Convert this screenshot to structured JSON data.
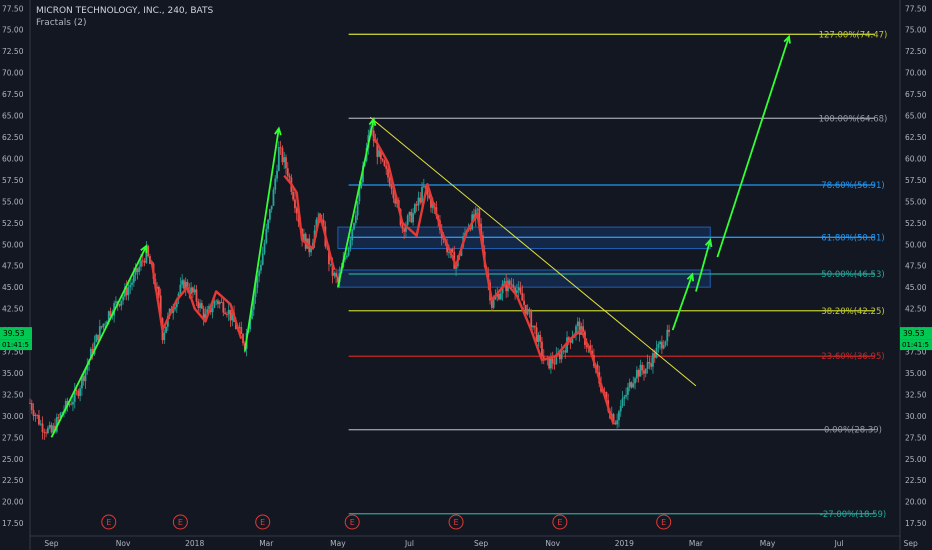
{
  "header": {
    "symbol_title": "MICRON TECHNOLOGY, INC., 240, BATS",
    "indicator": "Fractals (2)"
  },
  "price_labels": {
    "last_price": "39.53",
    "countdown": "01:41:5"
  },
  "colors": {
    "background": "#131722",
    "candle_up": "#26a69a",
    "candle_down": "#ef5350",
    "fib_grey": "#9598a1",
    "fib_blue": "#2196f3",
    "fib_teal": "#26a69a",
    "fib_olive": "#c0ca33",
    "fib_red": "#c62828",
    "trend_green": "#33ff33",
    "trend_red": "#e53935",
    "trendline_yellow": "#e0e040",
    "earnings_badge": "#e53935"
  },
  "chart_data": {
    "type": "candlestick",
    "title": "MICRON TECHNOLOGY, INC., 240, BATS",
    "yaxis": {
      "min": 16,
      "max": 78,
      "ticks": [
        "17.50",
        "20.00",
        "22.50",
        "25.00",
        "27.50",
        "30.00",
        "32.50",
        "35.00",
        "37.50",
        "40.00",
        "42.50",
        "45.00",
        "47.50",
        "50.00",
        "52.50",
        "55.00",
        "57.50",
        "60.00",
        "62.50",
        "65.00",
        "67.50",
        "70.00",
        "72.50",
        "75.00",
        "77.50"
      ]
    },
    "xaxis": {
      "range_months": [
        -0.6,
        23.7
      ],
      "ticks": [
        {
          "label": "Sep",
          "m": 0
        },
        {
          "label": "Nov",
          "m": 2
        },
        {
          "label": "2018",
          "m": 4
        },
        {
          "label": "Mar",
          "m": 6
        },
        {
          "label": "May",
          "m": 8
        },
        {
          "label": "Jul",
          "m": 10
        },
        {
          "label": "Sep",
          "m": 12
        },
        {
          "label": "Nov",
          "m": 14
        },
        {
          "label": "2019",
          "m": 16
        },
        {
          "label": "Mar",
          "m": 18
        },
        {
          "label": "May",
          "m": 20
        },
        {
          "label": "Jul",
          "m": 22
        },
        {
          "label": "Sep",
          "m": 24
        }
      ]
    },
    "price_path": [
      {
        "m": -0.6,
        "p": 31.5
      },
      {
        "m": -0.3,
        "p": 29.0
      },
      {
        "m": 0.0,
        "p": 28.0
      },
      {
        "m": 0.3,
        "p": 30.5
      },
      {
        "m": 0.7,
        "p": 32.5
      },
      {
        "m": 1.0,
        "p": 36.0
      },
      {
        "m": 1.3,
        "p": 39.5
      },
      {
        "m": 1.6,
        "p": 42.0
      },
      {
        "m": 2.0,
        "p": 44.0
      },
      {
        "m": 2.3,
        "p": 46.0
      },
      {
        "m": 2.65,
        "p": 49.0
      },
      {
        "m": 2.8,
        "p": 47.0
      },
      {
        "m": 3.0,
        "p": 43.5
      },
      {
        "m": 3.1,
        "p": 39.5
      },
      {
        "m": 3.4,
        "p": 43.0
      },
      {
        "m": 3.7,
        "p": 45.5
      },
      {
        "m": 4.0,
        "p": 44.0
      },
      {
        "m": 4.3,
        "p": 41.5
      },
      {
        "m": 4.6,
        "p": 43.5
      },
      {
        "m": 4.9,
        "p": 42.5
      },
      {
        "m": 5.2,
        "p": 40.0
      },
      {
        "m": 5.4,
        "p": 38.5
      },
      {
        "m": 5.6,
        "p": 43.0
      },
      {
        "m": 5.9,
        "p": 49.0
      },
      {
        "m": 6.2,
        "p": 56.0
      },
      {
        "m": 6.35,
        "p": 61.0
      },
      {
        "m": 6.6,
        "p": 58.5
      },
      {
        "m": 6.8,
        "p": 55.0
      },
      {
        "m": 7.0,
        "p": 51.0
      },
      {
        "m": 7.2,
        "p": 49.5
      },
      {
        "m": 7.5,
        "p": 53.5
      },
      {
        "m": 7.8,
        "p": 47.0
      },
      {
        "m": 8.0,
        "p": 45.5
      },
      {
        "m": 8.3,
        "p": 50.0
      },
      {
        "m": 8.6,
        "p": 56.0
      },
      {
        "m": 8.9,
        "p": 63.5
      },
      {
        "m": 9.2,
        "p": 59.5
      },
      {
        "m": 9.5,
        "p": 57.0
      },
      {
        "m": 9.8,
        "p": 52.0
      },
      {
        "m": 10.1,
        "p": 53.5
      },
      {
        "m": 10.4,
        "p": 56.5
      },
      {
        "m": 10.7,
        "p": 54.0
      },
      {
        "m": 11.0,
        "p": 50.0
      },
      {
        "m": 11.3,
        "p": 47.5
      },
      {
        "m": 11.6,
        "p": 52.0
      },
      {
        "m": 11.9,
        "p": 53.5
      },
      {
        "m": 12.1,
        "p": 48.0
      },
      {
        "m": 12.3,
        "p": 43.0
      },
      {
        "m": 12.6,
        "p": 45.0
      },
      {
        "m": 12.9,
        "p": 45.5
      },
      {
        "m": 13.2,
        "p": 43.0
      },
      {
        "m": 13.5,
        "p": 40.0
      },
      {
        "m": 13.8,
        "p": 36.0
      },
      {
        "m": 14.1,
        "p": 36.5
      },
      {
        "m": 14.4,
        "p": 38.5
      },
      {
        "m": 14.7,
        "p": 40.5
      },
      {
        "m": 15.0,
        "p": 38.0
      },
      {
        "m": 15.3,
        "p": 34.0
      },
      {
        "m": 15.6,
        "p": 30.5
      },
      {
        "m": 15.75,
        "p": 29.5
      },
      {
        "m": 16.0,
        "p": 32.0
      },
      {
        "m": 16.3,
        "p": 35.0
      },
      {
        "m": 16.6,
        "p": 35.5
      },
      {
        "m": 16.9,
        "p": 37.5
      },
      {
        "m": 17.1,
        "p": 39.0
      },
      {
        "m": 17.3,
        "p": 39.5
      }
    ],
    "fibonacci": {
      "start_m": 8.3,
      "end_m": 23.0,
      "levels": [
        {
          "label": "127.00%(74.47)",
          "price": 74.47,
          "color": "#c0ca33"
        },
        {
          "label": "100.00%(64.68)",
          "price": 64.68,
          "color": "#9598a1"
        },
        {
          "label": "78.60%(56.91)",
          "price": 56.91,
          "color": "#2196f3"
        },
        {
          "label": "61.80%(50.81)",
          "price": 50.81,
          "color": "#2196f3"
        },
        {
          "label": "50.00%(46.53)",
          "price": 46.53,
          "color": "#26a69a"
        },
        {
          "label": "38.20%(42.25)",
          "price": 42.25,
          "color": "#c0ca33"
        },
        {
          "label": "23.60%(36.95)",
          "price": 36.95,
          "color": "#c62828"
        },
        {
          "label": "0.00%(28.39)",
          "price": 28.39,
          "color": "#9598a1"
        },
        {
          "label": "-27.00%(18.59)",
          "price": 18.59,
          "color": "#26a69a"
        }
      ]
    },
    "zones": [
      {
        "from_m": 8.0,
        "to_m": 18.4,
        "low": 49.5,
        "high": 52.0
      },
      {
        "from_m": 8.0,
        "to_m": 18.4,
        "low": 45.0,
        "high": 47.0
      }
    ],
    "green_lines": [
      [
        {
          "m": 0.0,
          "p": 27.5
        },
        {
          "m": 2.65,
          "p": 49.8
        }
      ],
      [
        {
          "m": 5.4,
          "p": 37.5
        },
        {
          "m": 6.35,
          "p": 63.5
        }
      ],
      [
        {
          "m": 8.0,
          "p": 45.0
        },
        {
          "m": 9.0,
          "p": 64.6
        }
      ]
    ],
    "red_lines": [
      [
        {
          "m": 2.8,
          "p": 48.0
        },
        {
          "m": 3.1,
          "p": 40.0
        },
        {
          "m": 3.5,
          "p": 43.5
        },
        {
          "m": 3.8,
          "p": 45.0
        },
        {
          "m": 4.0,
          "p": 42.5
        },
        {
          "m": 4.3,
          "p": 41.0
        },
        {
          "m": 4.6,
          "p": 44.5
        },
        {
          "m": 5.0,
          "p": 43.0
        },
        {
          "m": 5.3,
          "p": 39.0
        }
      ],
      [
        {
          "m": 6.5,
          "p": 58.0
        },
        {
          "m": 6.7,
          "p": 57.0
        },
        {
          "m": 6.85,
          "p": 56.0
        },
        {
          "m": 7.0,
          "p": 50.5
        },
        {
          "m": 7.3,
          "p": 49.5
        },
        {
          "m": 7.5,
          "p": 53.5
        },
        {
          "m": 7.8,
          "p": 48.5
        },
        {
          "m": 7.9,
          "p": 47.0
        }
      ],
      [
        {
          "m": 9.0,
          "p": 62.5
        },
        {
          "m": 9.4,
          "p": 59.5
        },
        {
          "m": 9.8,
          "p": 52.5
        },
        {
          "m": 10.2,
          "p": 51.0
        },
        {
          "m": 10.5,
          "p": 57.0
        },
        {
          "m": 10.9,
          "p": 51.5
        },
        {
          "m": 11.3,
          "p": 47.5
        },
        {
          "m": 11.6,
          "p": 51.5
        },
        {
          "m": 11.9,
          "p": 53.5
        },
        {
          "m": 12.1,
          "p": 48.0
        },
        {
          "m": 12.3,
          "p": 43.5
        },
        {
          "m": 12.7,
          "p": 45.5
        },
        {
          "m": 13.0,
          "p": 44.0
        },
        {
          "m": 13.4,
          "p": 40.0
        },
        {
          "m": 13.7,
          "p": 36.5
        },
        {
          "m": 14.1,
          "p": 37.0
        },
        {
          "m": 14.5,
          "p": 39.0
        },
        {
          "m": 14.8,
          "p": 40.0
        },
        {
          "m": 15.1,
          "p": 37.0
        },
        {
          "m": 15.4,
          "p": 33.0
        },
        {
          "m": 15.7,
          "p": 29.0
        }
      ]
    ],
    "trendline": [
      {
        "m": 8.9,
        "p": 64.8
      },
      {
        "m": 18.0,
        "p": 33.5
      }
    ],
    "projection_arrows": [
      [
        {
          "m": 17.35,
          "p": 40.0
        },
        {
          "m": 17.9,
          "p": 46.5
        }
      ],
      [
        {
          "m": 18.0,
          "p": 44.5
        },
        {
          "m": 18.4,
          "p": 50.5
        }
      ],
      [
        {
          "m": 18.6,
          "p": 48.5
        },
        {
          "m": 20.6,
          "p": 74.2
        }
      ]
    ],
    "earnings_markers": [
      1.6,
      3.6,
      5.9,
      8.4,
      11.3,
      14.2,
      17.1
    ]
  }
}
